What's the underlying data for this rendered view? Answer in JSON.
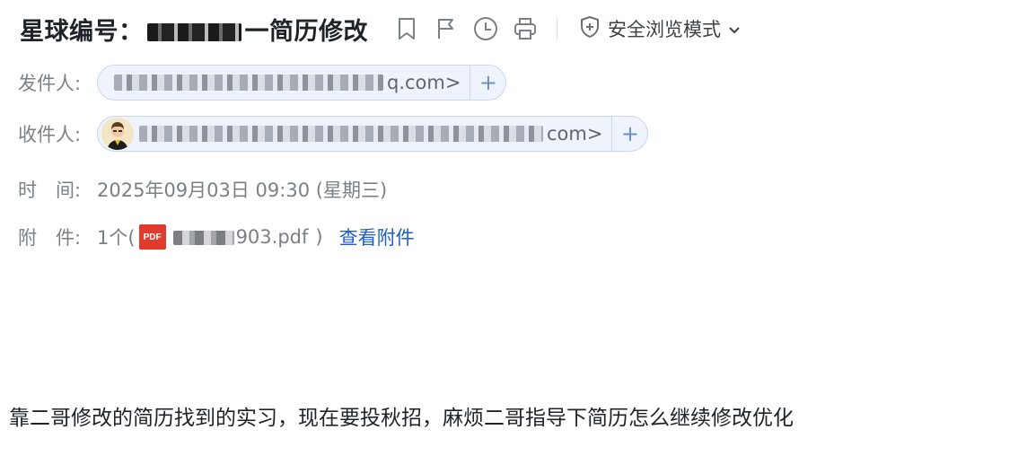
{
  "subject": {
    "prefix": "星球编号：",
    "suffix": "一简历修改"
  },
  "actions": {
    "icons": [
      "bookmark-icon",
      "flag-icon",
      "clock-icon",
      "print-icon"
    ],
    "safe_mode_label": "安全浏览模式"
  },
  "sender": {
    "label": "发件人:",
    "address_tail": "q.com>"
  },
  "recipient": {
    "label": "收件人:",
    "address_tail": "com>"
  },
  "time": {
    "label": "时　间:",
    "value": "2025年09月03日 09:30 (星期三)"
  },
  "attachment": {
    "label": "附　件:",
    "count": "1个(",
    "file_icon": "PDF",
    "name_tail": "903.pdf",
    "close_paren": ")",
    "view_link": "查看附件"
  },
  "message": {
    "body": "靠二哥修改的简历找到的实习，现在要投秋招，麻烦二哥指导下简历怎么继续修改优化"
  },
  "colors": {
    "link": "#1e5ccf",
    "chip_bg": "#eef3fc",
    "chip_border": "#c9d6ee",
    "pdf": "#e23b2e"
  }
}
